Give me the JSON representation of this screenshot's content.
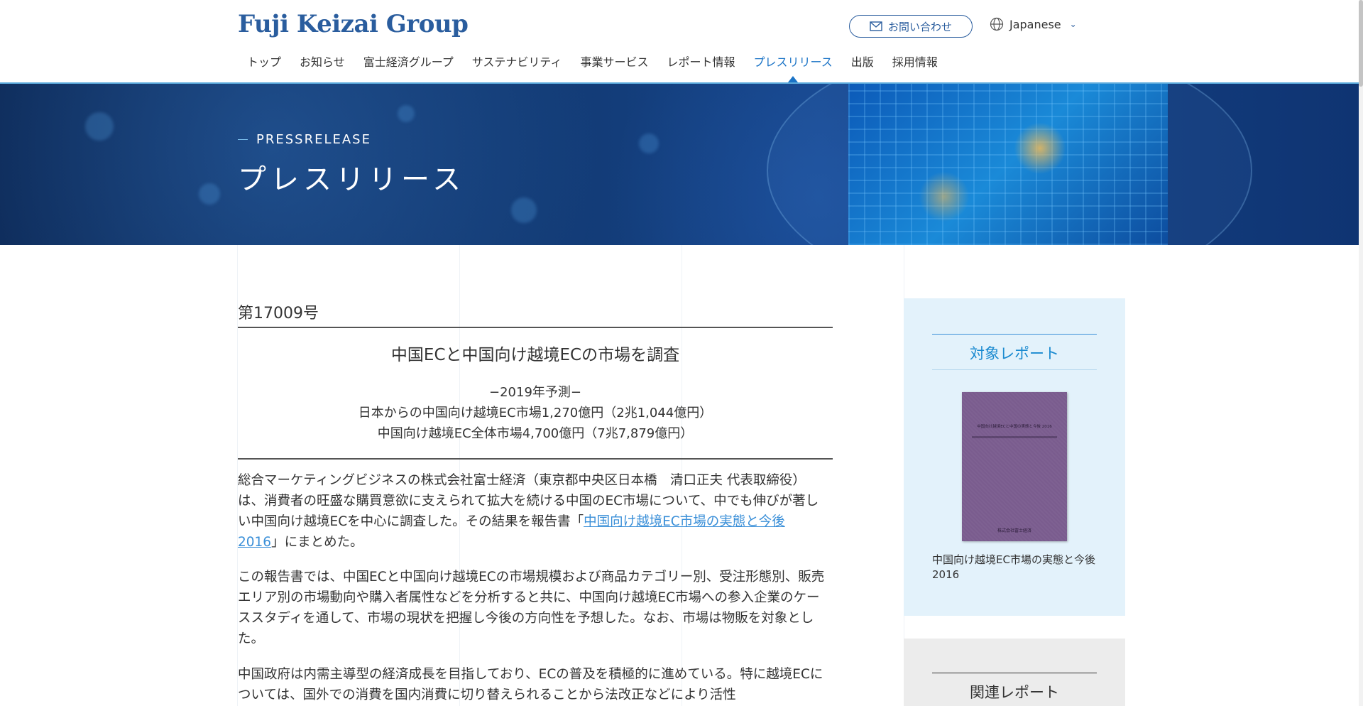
{
  "header": {
    "logo": "Fuji Keizai Group",
    "contact_label": "お問い合わせ",
    "language_label": "Japanese",
    "nav": [
      {
        "label": "トップ",
        "active": false
      },
      {
        "label": "お知らせ",
        "active": false
      },
      {
        "label": "富士経済グループ",
        "active": false
      },
      {
        "label": "サステナビリティ",
        "active": false
      },
      {
        "label": "事業サービス",
        "active": false
      },
      {
        "label": "レポート情報",
        "active": false
      },
      {
        "label": "プレスリリース",
        "active": true
      },
      {
        "label": "出版",
        "active": false
      },
      {
        "label": "採用情報",
        "active": false
      }
    ]
  },
  "hero": {
    "eyebrow": "PRESSRELEASE",
    "title": "プレスリリース"
  },
  "article": {
    "issue": "第17009号",
    "headline": "中国ECと中国向け越境ECの市場を調査",
    "sub1": "−2019年予測−",
    "sub2": "日本からの中国向け越境EC市場1,270億円（2兆1,044億円）",
    "sub3": "中国向け越境EC全体市場4,700億円（7兆7,879億円）",
    "p1_before": "総合マーケティングビジネスの株式会社富士経済（東京都中央区日本橋　清口正夫 代表取締役）は、消費者の旺盛な購買意欲に支えられて拡大を続ける中国のEC市場について、中でも伸びが著しい中国向け越境ECを中心に調査した。その結果を報告書「",
    "p1_link": "中国向け越境EC市場の実態と今後 2016",
    "p1_after": "」にまとめた。",
    "p2": "この報告書では、中国ECと中国向け越境ECの市場規模および商品カテゴリー別、受注形態別、販売エリア別の市場動向や購入者属性などを分析すると共に、中国向け越境EC市場への参入企業のケーススタディを通して、市場の現状を把握し今後の方向性を予想した。なお、市場は物販を対象とした。",
    "p3": "中国政府は内需主導型の経済成長を目指しており、ECの普及を積極的に進めている。特に越境ECについては、国外での消費を国内消費に切り替えられることから法改正などにより活性"
  },
  "sidebar": {
    "target_title": "対象レポート",
    "book_cover_title": "中国向け越境ECと中国の実態と今後 2016",
    "book_publisher": "株式会社富士経済",
    "book_caption": "中国向け越境EC市場の実態と今後 2016",
    "related_title": "関連レポート"
  },
  "colors": {
    "brand": "#2a5d9e",
    "accent": "#1a73c6",
    "link": "#3a8fd8",
    "sidebar_bg": "#e3f2fb",
    "related_bg": "#ececec"
  },
  "icons": {
    "contact": "mail-icon",
    "language": "globe-icon",
    "language_toggle": "chevron-down-icon"
  }
}
